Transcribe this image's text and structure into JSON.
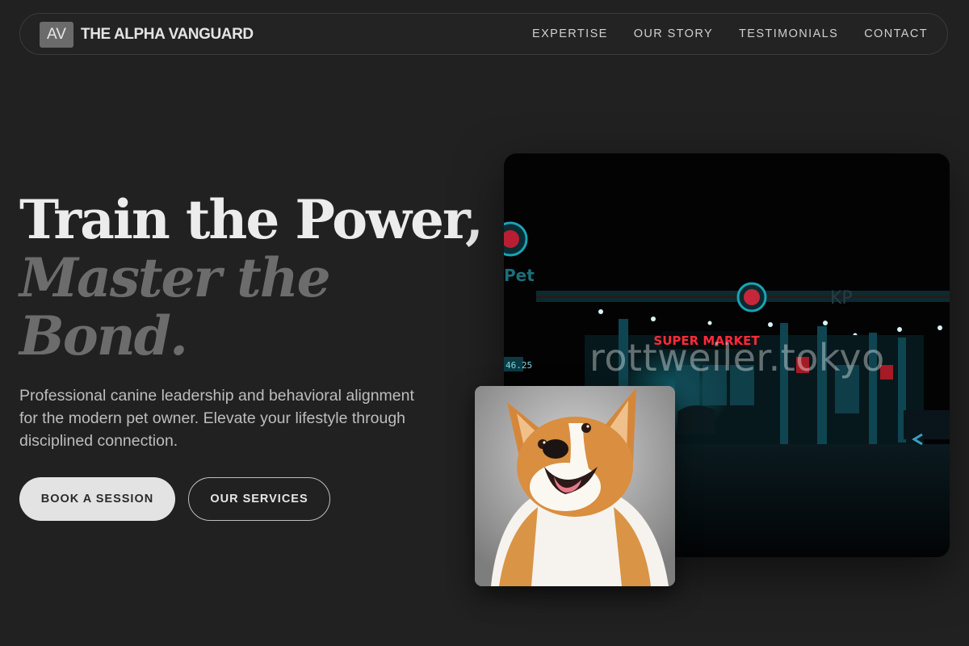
{
  "nav": {
    "logo_mark": "AV",
    "brand": "THE ALPHA VANGUARD",
    "links": [
      "EXPERTISE",
      "OUR STORY",
      "TESTIMONIALS",
      "CONTACT"
    ]
  },
  "hero": {
    "title_line_1": "Train the Power,",
    "title_line_2": "Master the",
    "title_line_3": "Bond.",
    "subtitle": "Professional canine leadership and behavioral alignment for the modern pet owner. Elevate your lifestyle through disciplined connection.",
    "primary_button": "BOOK A SESSION",
    "secondary_button": "OUR SERVICES"
  },
  "photo": {
    "watermark": "rottweiler.tokyo",
    "store_sign": "SUPER MARKET",
    "corner_sign": "KP",
    "left_sign": "Pet",
    "price_sign": "46.25"
  },
  "colors": {
    "background": "#212121",
    "primary_button": "#e3e3e3",
    "title_accent": "#6c6c6c",
    "neon_red": "#ff2a3a",
    "neon_teal": "#1aa3b5"
  }
}
